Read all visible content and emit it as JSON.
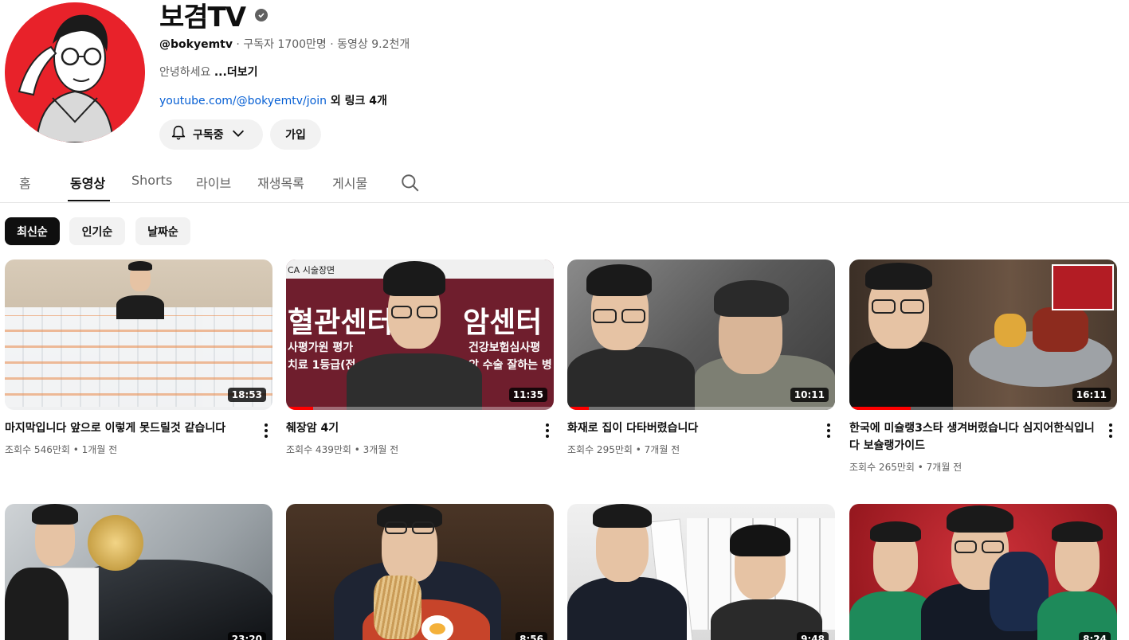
{
  "channel": {
    "name": "보겸TV",
    "handle": "@bokyemtv",
    "stats": " · 구독자 1700만명 · 동영상 9.2천개",
    "description": "안녕하세요 ",
    "more_label": "...더보기",
    "link_url": "youtube.com/@bokyemtv/join",
    "link_extra": " 외 링크 4개",
    "subscribe_label": "구독중",
    "join_label": "가입"
  },
  "tabs": [
    {
      "label": "홈"
    },
    {
      "label": "동영상"
    },
    {
      "label": "Shorts"
    },
    {
      "label": "라이브"
    },
    {
      "label": "재생목록"
    },
    {
      "label": "게시물"
    }
  ],
  "chips": [
    {
      "label": "최신순"
    },
    {
      "label": "인기순"
    },
    {
      "label": "날짜순"
    }
  ],
  "thumb_text": {
    "v2_top": "CA 시술장면",
    "v2_left_big": "혈관센터",
    "v2_left_l1": "사평가원 평가",
    "v2_left_l2": "치료 1등급(전",
    "v2_right_big": "암센터",
    "v2_right_l1": "건강보험심사평",
    "v2_right_l2": "암 수술 잘하는 병"
  },
  "videos": [
    {
      "title": "마지막입니다 앞으로 이렇게 못드릴것 같습니다",
      "views": "조회수 546만회",
      "age": "1개월 전",
      "duration": "18:53",
      "watched": 0
    },
    {
      "title": "췌장암 4기",
      "views": "조회수 439만회",
      "age": "3개월 전",
      "duration": "11:35",
      "watched": 0.1
    },
    {
      "title": "화재로 집이 다타버렸습니다",
      "views": "조회수 295만회",
      "age": "7개월 전",
      "duration": "10:11",
      "watched": 0.08
    },
    {
      "title": "한국에 미슐랭3스타 생겨버렸습니다 심지어한식입니다 보슐랭가이드",
      "views": "조회수 265만회",
      "age": "7개월 전",
      "duration": "16:11",
      "watched": 0.23
    },
    {
      "title": "",
      "views": "",
      "age": "",
      "duration": "23:20",
      "watched": 0
    },
    {
      "title": "",
      "views": "",
      "age": "",
      "duration": "8:56",
      "watched": 0
    },
    {
      "title": "",
      "views": "",
      "age": "",
      "duration": "9:48",
      "watched": 0
    },
    {
      "title": "",
      "views": "",
      "age": "",
      "duration": "8:24",
      "watched": 0
    }
  ],
  "colors": {
    "accent_red": "#ff0000",
    "link_blue": "#065fd4",
    "avatar_red": "#e8222a"
  }
}
